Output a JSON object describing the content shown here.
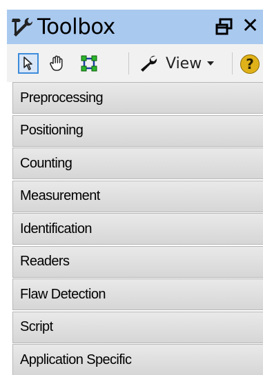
{
  "title": "Toolbox",
  "title_icon": "tools-icon",
  "window_buttons": {
    "float": "float-window-icon",
    "close": "✕"
  },
  "toolbar": {
    "tools": [
      {
        "name": "pointer-icon",
        "selected": true
      },
      {
        "name": "pan-hand-icon",
        "selected": false
      },
      {
        "name": "region-select-icon",
        "selected": false
      }
    ],
    "view_label": "View",
    "help_icon": "?"
  },
  "categories": [
    "Preprocessing",
    "Positioning",
    "Counting",
    "Measurement",
    "Identification",
    "Readers",
    "Flaw Detection",
    "Script",
    "Application Specific"
  ],
  "colors": {
    "titlebar": "#a9c9ef",
    "toolbar": "#f1f1f1",
    "selected_tool_border": "#3d8bdb",
    "help": "#e0b21a"
  }
}
